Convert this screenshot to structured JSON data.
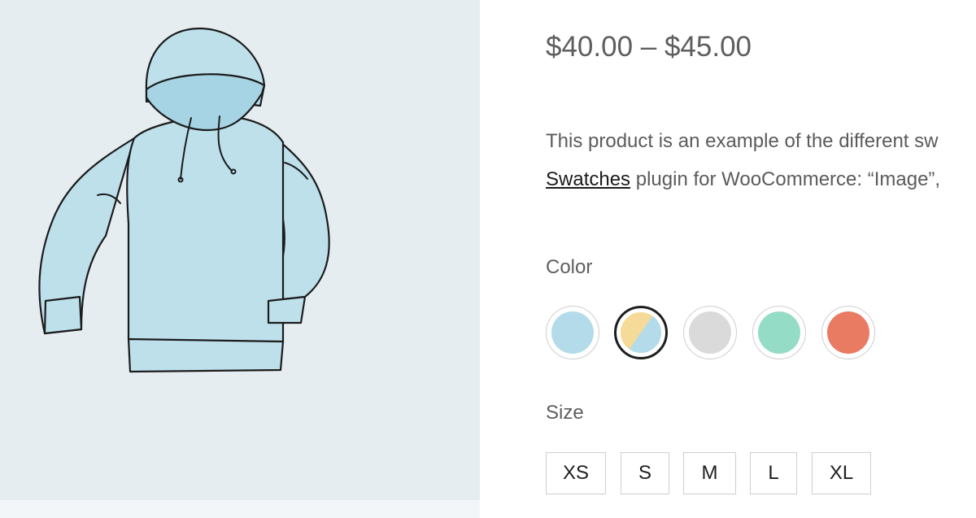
{
  "product": {
    "price": "$40.00 – $45.00",
    "description": {
      "line1": "This product is an example of the different sw",
      "link_text": "Swatches",
      "line2_rest": " plugin for WooCommerce: “Image”,"
    }
  },
  "attributes": {
    "color": {
      "label": "Color",
      "swatches": [
        {
          "name": "light-blue",
          "color": "#b3dbe9"
        },
        {
          "name": "yellow-blue",
          "color": "#f5da98",
          "color2": "#b3dbe9",
          "selected": true
        },
        {
          "name": "gray",
          "color": "#dadada"
        },
        {
          "name": "mint",
          "color": "#95dcc6"
        },
        {
          "name": "coral",
          "color": "#e97b63"
        }
      ]
    },
    "size": {
      "label": "Size",
      "options": [
        "XS",
        "S",
        "M",
        "L",
        "XL"
      ]
    }
  }
}
